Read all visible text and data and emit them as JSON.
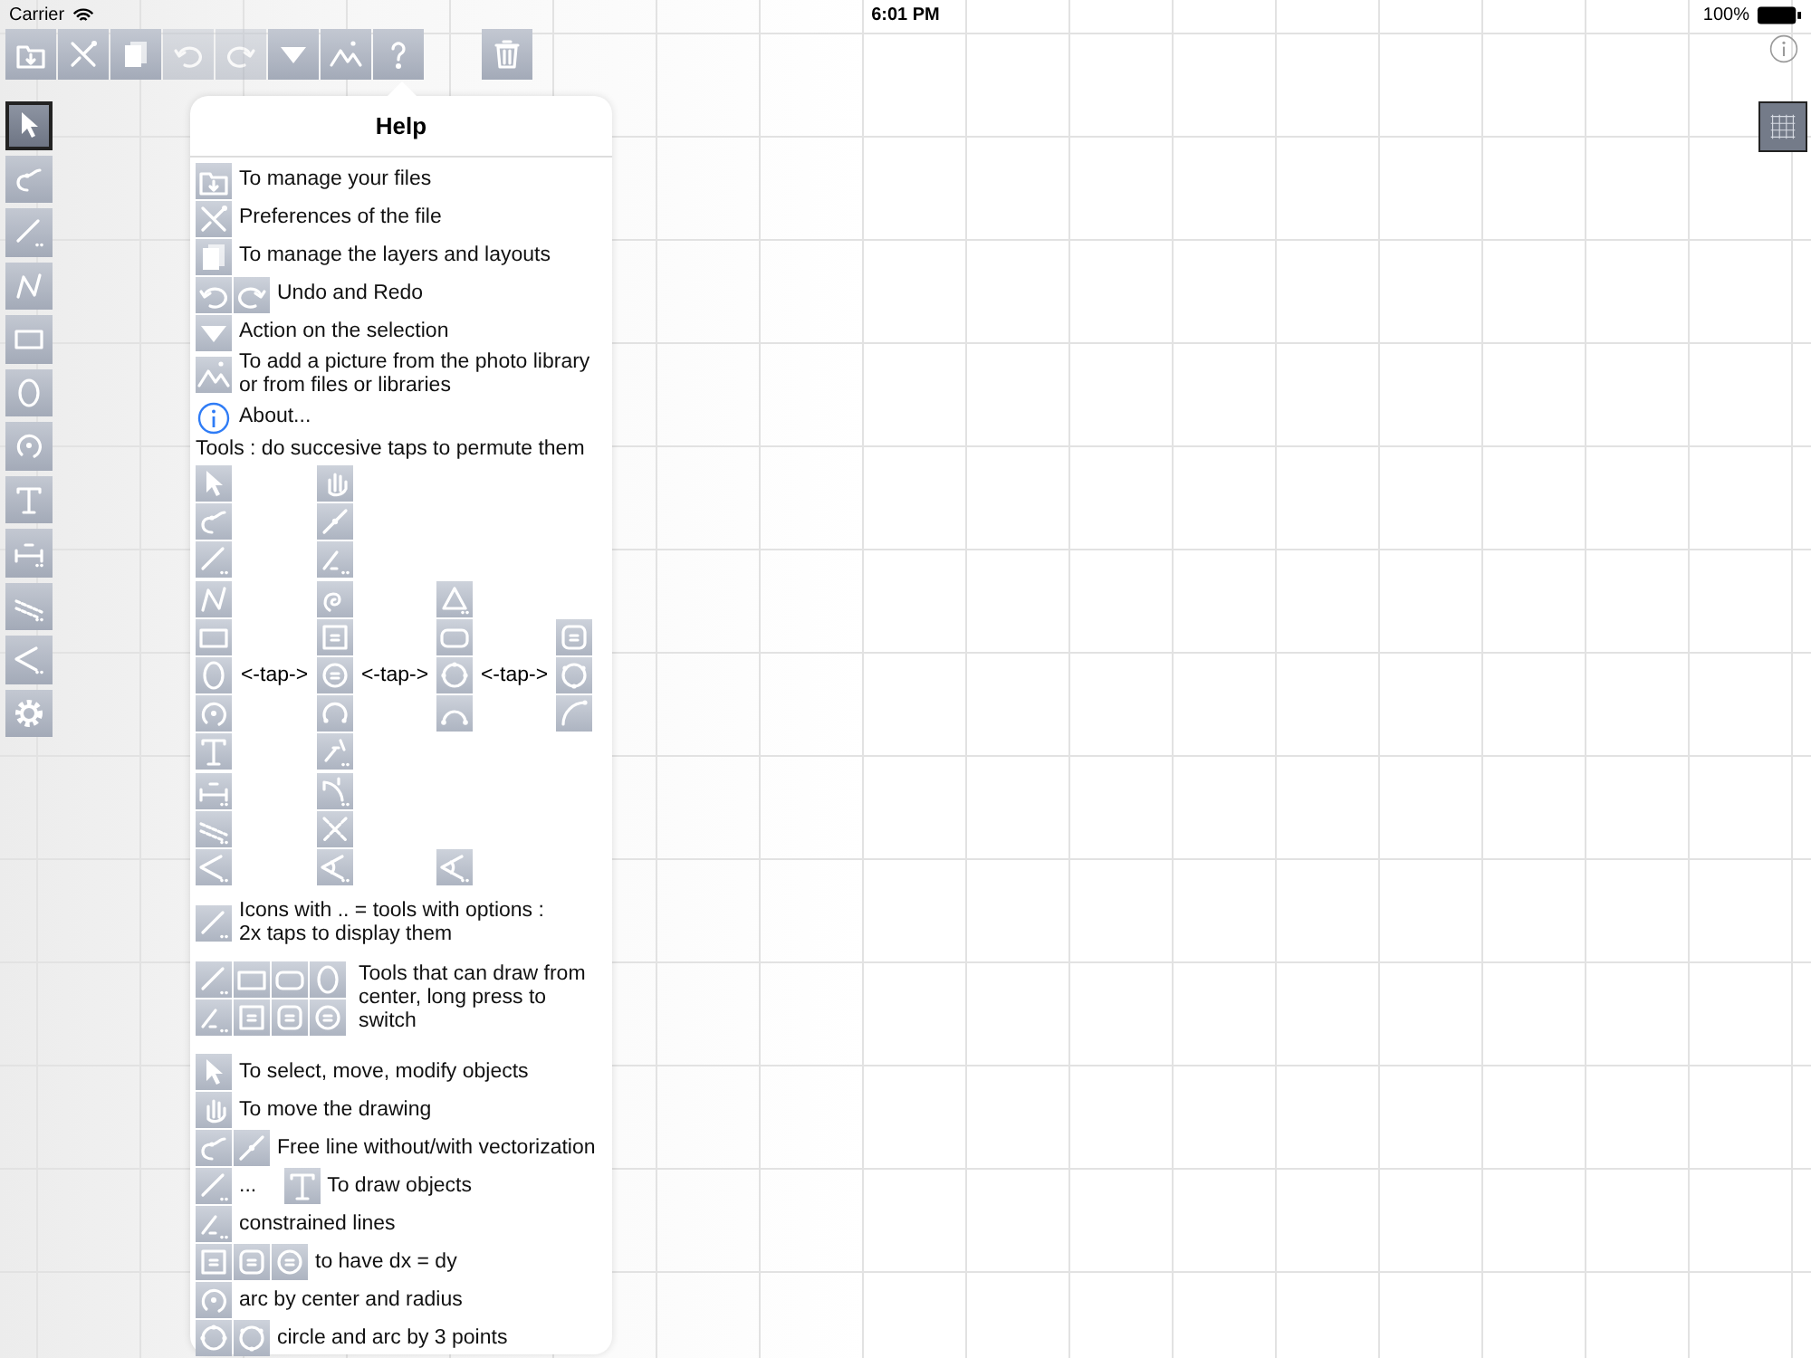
{
  "status_bar": {
    "carrier": "Carrier",
    "time": "6:01 PM",
    "battery": "100%"
  },
  "toolbar": {
    "main": [
      {
        "disabled": false
      },
      {
        "disabled": false
      },
      {
        "disabled": false
      },
      {
        "disabled": true
      },
      {
        "disabled": true
      },
      {
        "disabled": false
      },
      {
        "disabled": false
      },
      {
        "disabled": false
      }
    ],
    "end": [
      {
        "disabled": false
      }
    ]
  },
  "tools": [
    {
      "selected": true
    },
    {
      "selected": false
    },
    {
      "selected": false
    },
    {
      "selected": false
    },
    {
      "selected": false
    },
    {
      "selected": false
    },
    {
      "selected": false
    },
    {
      "selected": false
    },
    {
      "selected": false
    },
    {
      "selected": false
    },
    {
      "selected": false
    },
    {
      "selected": false
    }
  ],
  "grid_button": {
    "selected": true
  },
  "help": {
    "title": "Help",
    "rows": [
      {
        "kind": "row",
        "parts": [
          {
            "kind": "icon"
          },
          {
            "kind": "text",
            "text": "To manage your files"
          }
        ]
      },
      {
        "kind": "row",
        "parts": [
          {
            "kind": "icon"
          },
          {
            "kind": "text",
            "text": "Preferences of the file"
          }
        ]
      },
      {
        "kind": "row",
        "parts": [
          {
            "kind": "icon"
          },
          {
            "kind": "text",
            "text": "To manage the layers and layouts"
          }
        ]
      },
      {
        "kind": "row",
        "parts": [
          {
            "kind": "icon"
          },
          {
            "kind": "icon"
          },
          {
            "kind": "text",
            "text": "Undo and Redo"
          }
        ]
      },
      {
        "kind": "row",
        "parts": [
          {
            "kind": "icon"
          },
          {
            "kind": "text",
            "text": "Action on the selection"
          }
        ]
      },
      {
        "kind": "row",
        "parts": [
          {
            "kind": "icon"
          },
          {
            "kind": "text",
            "text": "To add a picture from the photo library\nor from files or libraries"
          }
        ]
      },
      {
        "kind": "row",
        "parts": [
          {
            "kind": "icon"
          },
          {
            "kind": "text",
            "text": "About..."
          }
        ]
      },
      {
        "kind": "heading",
        "text": "Tools : do succesive taps to permute them"
      },
      {
        "kind": "tap_grid",
        "columns": [
          [
            {
              "kind": "icon"
            },
            {
              "kind": "icon"
            },
            {
              "kind": "icon"
            },
            {
              "kind": "icon"
            },
            {
              "kind": "icon"
            },
            {
              "kind": "icon"
            },
            {
              "kind": "icon"
            },
            {
              "kind": "icon"
            },
            {
              "kind": "icon"
            },
            {
              "kind": "icon"
            },
            {
              "kind": "icon"
            }
          ],
          [
            {
              "kind": "icon"
            },
            {
              "kind": "icon"
            },
            {
              "kind": "icon"
            },
            {
              "kind": "icon"
            },
            {
              "kind": "icon"
            },
            {
              "kind": "icon"
            },
            {
              "kind": "icon"
            },
            {
              "kind": "icon"
            },
            {
              "kind": "icon"
            },
            {
              "kind": "icon"
            },
            {
              "kind": "icon"
            }
          ],
          [
            {
              "kind": "blank"
            },
            {
              "kind": "blank"
            },
            {
              "kind": "blank"
            },
            {
              "kind": "icon"
            },
            {
              "kind": "icon"
            },
            {
              "kind": "icon"
            },
            {
              "kind": "icon"
            },
            {
              "kind": "blank"
            },
            {
              "kind": "blank"
            },
            {
              "kind": "blank"
            },
            {
              "kind": "icon"
            }
          ],
          [
            {
              "kind": "blank"
            },
            {
              "kind": "blank"
            },
            {
              "kind": "blank"
            },
            {
              "kind": "blank"
            },
            {
              "kind": "icon"
            },
            {
              "kind": "icon"
            },
            {
              "kind": "icon"
            },
            {
              "kind": "blank"
            },
            {
              "kind": "blank"
            },
            {
              "kind": "blank"
            },
            {
              "kind": "blank"
            }
          ]
        ],
        "taps": [
          "<-tap->",
          "<-tap->",
          "<-tap->"
        ]
      },
      {
        "kind": "row",
        "parts": [
          {
            "kind": "icon"
          },
          {
            "kind": "text",
            "text": "Icons with .. = tools with options :\n2x taps to display them"
          }
        ]
      },
      {
        "kind": "block",
        "icon_rows": [
          [
            {
              "kind": "icon"
            },
            {
              "kind": "icon"
            },
            {
              "kind": "icon"
            },
            {
              "kind": "icon"
            }
          ],
          [
            {
              "kind": "icon"
            },
            {
              "kind": "icon"
            },
            {
              "kind": "icon"
            },
            {
              "kind": "icon"
            }
          ]
        ],
        "text": "Tools that can draw from\ncenter, long press to\nswitch"
      },
      {
        "kind": "row",
        "parts": [
          {
            "kind": "icon"
          },
          {
            "kind": "text",
            "text": "To select, move, modify objects"
          }
        ]
      },
      {
        "kind": "row",
        "parts": [
          {
            "kind": "icon"
          },
          {
            "kind": "text",
            "text": "To move the drawing"
          }
        ]
      },
      {
        "kind": "row",
        "parts": [
          {
            "kind": "icon"
          },
          {
            "kind": "icon"
          },
          {
            "kind": "text",
            "text": "Free line without/with vectorization"
          }
        ]
      },
      {
        "kind": "row",
        "parts": [
          {
            "kind": "icon"
          },
          {
            "kind": "text",
            "text": "..."
          },
          {
            "kind": "icon"
          },
          {
            "kind": "text",
            "text": "To draw objects"
          }
        ]
      },
      {
        "kind": "row",
        "parts": [
          {
            "kind": "icon"
          },
          {
            "kind": "text",
            "text": "constrained lines"
          }
        ]
      },
      {
        "kind": "row",
        "parts": [
          {
            "kind": "icon"
          },
          {
            "kind": "icon"
          },
          {
            "kind": "icon"
          },
          {
            "kind": "text",
            "text": "to have dx = dy"
          }
        ]
      },
      {
        "kind": "row",
        "parts": [
          {
            "kind": "icon"
          },
          {
            "kind": "text",
            "text": "arc by center and radius"
          }
        ]
      },
      {
        "kind": "row",
        "parts": [
          {
            "kind": "icon"
          },
          {
            "kind": "icon"
          },
          {
            "kind": "text",
            "text": "circle and arc by 3 points"
          }
        ]
      }
    ]
  }
}
